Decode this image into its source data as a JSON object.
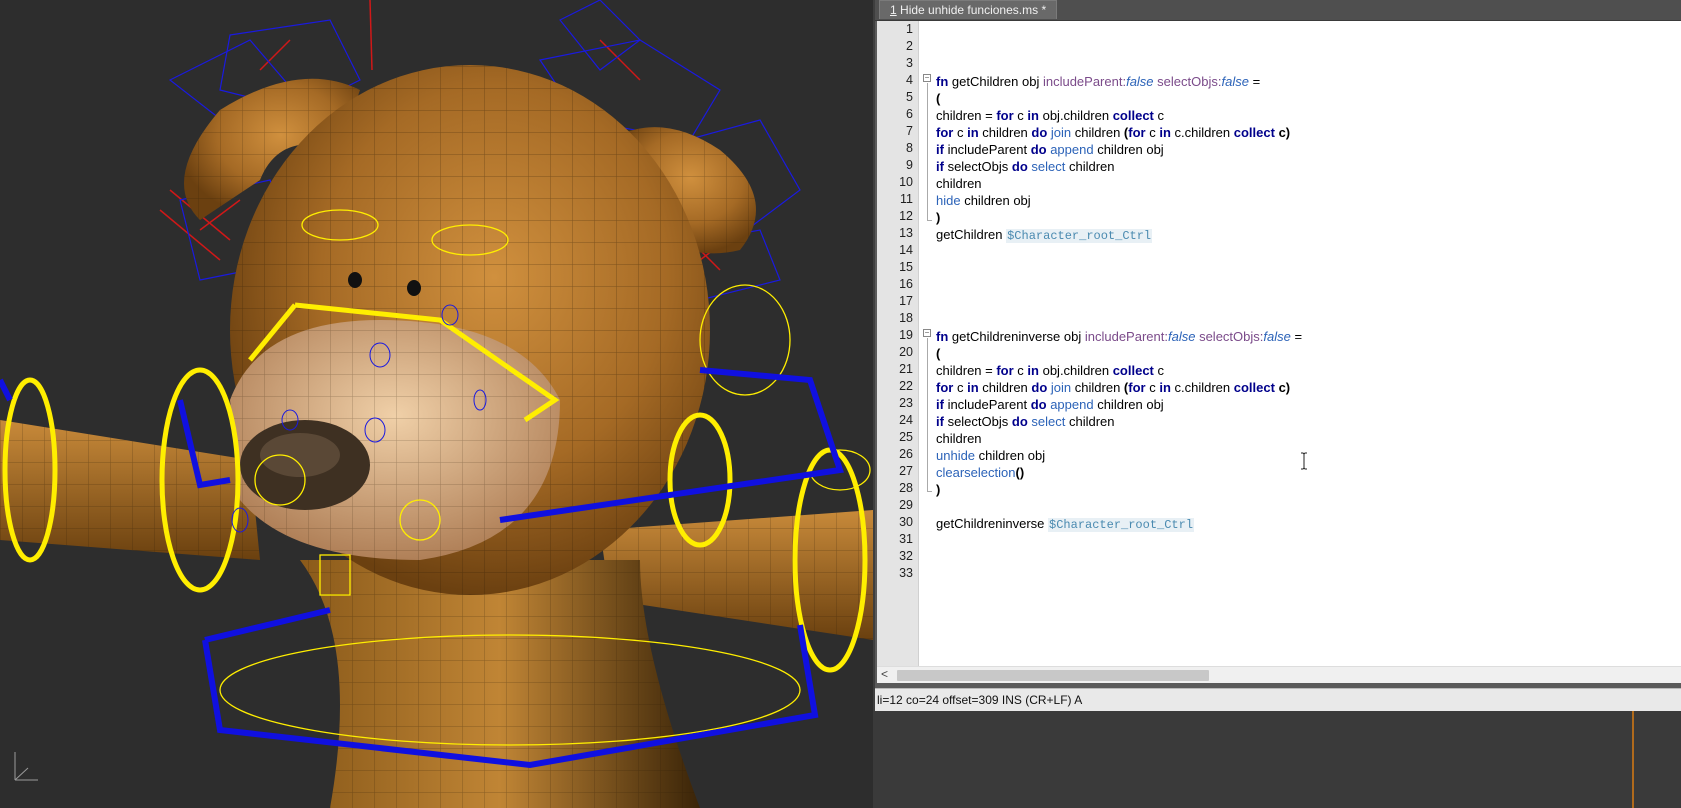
{
  "editor": {
    "tab_number": "1",
    "tab_title": " Hide unhide funciones.ms *",
    "status": "li=12 co=24 offset=309 INS (CR+LF) A",
    "scroll_left": "<",
    "line_numbers": [
      "1",
      "2",
      "3",
      "4",
      "5",
      "6",
      "7",
      "8",
      "9",
      "10",
      "11",
      "12",
      "13",
      "14",
      "15",
      "16",
      "17",
      "18",
      "19",
      "20",
      "21",
      "22",
      "23",
      "24",
      "25",
      "26",
      "27",
      "28",
      "29",
      "30",
      "31",
      "32",
      "33"
    ]
  },
  "code": {
    "fn_kw": "fn",
    "fn1_name": " getChildren obj ",
    "arg1": "includeParent:",
    "arg2": "selectObjs:",
    "false_val": "false",
    "eq": " =",
    "open": "(",
    "close": ")",
    "l5_a": "children = ",
    "for_kw": "for",
    "l5_b": " c ",
    "in_kw": "in",
    "l5_c": " obj.children ",
    "collect_kw": "collect",
    "l5_d": " c",
    "l6_b": " c ",
    "l6_c": " children ",
    "do_kw": "do",
    "join_fn": "join",
    "l6_d": " children ",
    "l6_e": "(",
    "l6_f": " c ",
    "l6_g": " c.children ",
    "l6_h": " c)",
    "if_kw": "if",
    "l7_b": " includeParent ",
    "append_fn": "append",
    "l7_d": " children obj",
    "l8_b": " selectObjs ",
    "select_fn": "select",
    "l8_d": " children",
    "l9": "children",
    "hide_fn": "hide",
    "l10_b": " children obj",
    "l12_a": "getChildren ",
    "root_ctrl": "$Character_root_Ctrl",
    "fn2_name": " getChildreninverse obj ",
    "unhide_fn": "unhide",
    "clearsel_fn": "clearselection",
    "parens": "()",
    "l29_a": "getChildreninverse "
  },
  "viewport": {
    "scene": "3d-viewport-teddy-bear-rig",
    "colors": {
      "background": "#2d2d2d",
      "fur": "#b87a2e",
      "muzzle": "#d9b48a",
      "control_yellow": "#ffee00",
      "control_blue": "#1010e0",
      "bone_red": "#e01010"
    }
  }
}
